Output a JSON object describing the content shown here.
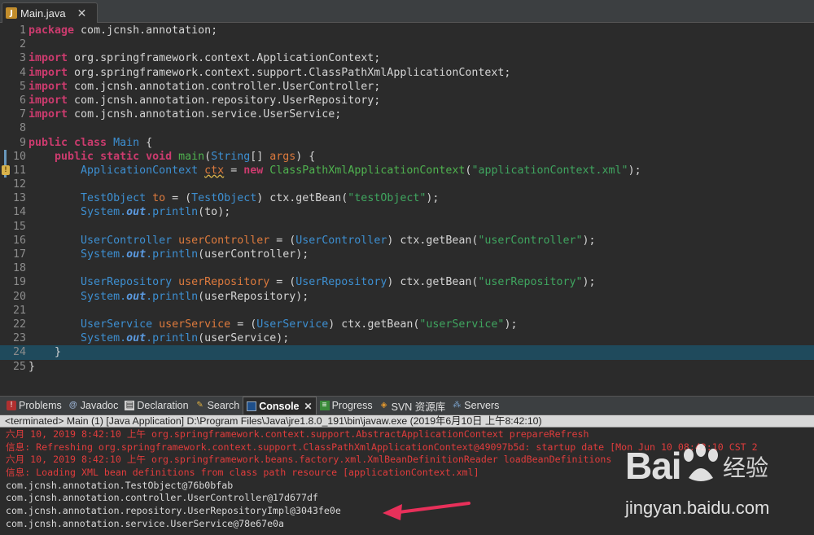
{
  "editor_tab": {
    "label": "Main.java",
    "icon": "java-file-icon",
    "close": "✕"
  },
  "code_lines": [
    {
      "n": "1",
      "parts": [
        [
          "kw",
          "package"
        ],
        [
          "plain",
          " com.jcnsh.annotation;"
        ]
      ]
    },
    {
      "n": "2",
      "parts": []
    },
    {
      "n": "3",
      "parts": [
        [
          "kw",
          "import"
        ],
        [
          "plain",
          " org.springframework.context.ApplicationContext;"
        ]
      ]
    },
    {
      "n": "4",
      "parts": [
        [
          "kw",
          "import"
        ],
        [
          "plain",
          " org.springframework.context.support.ClassPathXmlApplicationContext;"
        ]
      ]
    },
    {
      "n": "5",
      "parts": [
        [
          "kw",
          "import"
        ],
        [
          "plain",
          " com.jcnsh.annotation.controller.UserController;"
        ]
      ]
    },
    {
      "n": "6",
      "parts": [
        [
          "kw",
          "import"
        ],
        [
          "plain",
          " com.jcnsh.annotation.repository.UserRepository;"
        ]
      ]
    },
    {
      "n": "7",
      "parts": [
        [
          "kw",
          "import"
        ],
        [
          "plain",
          " com.jcnsh.annotation.service.UserService;"
        ]
      ]
    },
    {
      "n": "8",
      "parts": []
    },
    {
      "n": "9",
      "parts": [
        [
          "kw",
          "public class "
        ],
        [
          "type",
          "Main"
        ],
        [
          "plain",
          " {"
        ]
      ]
    },
    {
      "n": "10",
      "bar": true,
      "parts": [
        [
          "plain",
          "    "
        ],
        [
          "kw",
          "public static void "
        ],
        [
          "fn",
          "main"
        ],
        [
          "plain",
          "("
        ],
        [
          "type",
          "String"
        ],
        [
          "plain",
          "[] "
        ],
        [
          "var",
          "args"
        ],
        [
          "plain",
          ") {"
        ]
      ]
    },
    {
      "n": "11",
      "bar": true,
      "warn": true,
      "parts": [
        [
          "plain",
          "        "
        ],
        [
          "type",
          "ApplicationContext "
        ],
        [
          "var squig",
          "ctx"
        ],
        [
          "plain",
          " = "
        ],
        [
          "kw",
          "new "
        ],
        [
          "fn",
          "ClassPathXmlApplicationContext"
        ],
        [
          "plain",
          "("
        ],
        [
          "str",
          "\"applicationContext.xml\""
        ],
        [
          "plain",
          ");"
        ]
      ]
    },
    {
      "n": "12",
      "parts": []
    },
    {
      "n": "13",
      "parts": [
        [
          "plain",
          "        "
        ],
        [
          "type",
          "TestObject "
        ],
        [
          "var",
          "to"
        ],
        [
          "plain",
          " = ("
        ],
        [
          "type",
          "TestObject"
        ],
        [
          "plain",
          ") ctx.getBean("
        ],
        [
          "str",
          "\"testObject\""
        ],
        [
          "plain",
          ");"
        ]
      ]
    },
    {
      "n": "14",
      "parts": [
        [
          "plain",
          "        "
        ],
        [
          "type",
          "System."
        ],
        [
          "fld",
          "out"
        ],
        [
          "type",
          ".println"
        ],
        [
          "plain",
          "(to);"
        ]
      ]
    },
    {
      "n": "15",
      "parts": []
    },
    {
      "n": "16",
      "parts": [
        [
          "plain",
          "        "
        ],
        [
          "type",
          "UserController "
        ],
        [
          "var",
          "userController"
        ],
        [
          "plain",
          " = ("
        ],
        [
          "type",
          "UserController"
        ],
        [
          "plain",
          ") ctx.getBean("
        ],
        [
          "str",
          "\"userController\""
        ],
        [
          "plain",
          ");"
        ]
      ]
    },
    {
      "n": "17",
      "parts": [
        [
          "plain",
          "        "
        ],
        [
          "type",
          "System."
        ],
        [
          "fld",
          "out"
        ],
        [
          "type",
          ".println"
        ],
        [
          "plain",
          "(userController);"
        ]
      ]
    },
    {
      "n": "18",
      "parts": []
    },
    {
      "n": "19",
      "parts": [
        [
          "plain",
          "        "
        ],
        [
          "type",
          "UserRepository "
        ],
        [
          "var",
          "userRepository"
        ],
        [
          "plain",
          " = ("
        ],
        [
          "type",
          "UserRepository"
        ],
        [
          "plain",
          ") ctx.getBean("
        ],
        [
          "str",
          "\"userRepository\""
        ],
        [
          "plain",
          ");"
        ]
      ]
    },
    {
      "n": "20",
      "parts": [
        [
          "plain",
          "        "
        ],
        [
          "type",
          "System."
        ],
        [
          "fld",
          "out"
        ],
        [
          "type",
          ".println"
        ],
        [
          "plain",
          "(userRepository);"
        ]
      ]
    },
    {
      "n": "21",
      "parts": []
    },
    {
      "n": "22",
      "parts": [
        [
          "plain",
          "        "
        ],
        [
          "type",
          "UserService "
        ],
        [
          "var",
          "userService"
        ],
        [
          "plain",
          " = ("
        ],
        [
          "type",
          "UserService"
        ],
        [
          "plain",
          ") ctx.getBean("
        ],
        [
          "str",
          "\"userService\""
        ],
        [
          "plain",
          ");"
        ]
      ]
    },
    {
      "n": "23",
      "parts": [
        [
          "plain",
          "        "
        ],
        [
          "type",
          "System."
        ],
        [
          "fld",
          "out"
        ],
        [
          "type",
          ".println"
        ],
        [
          "plain",
          "(userService);"
        ]
      ]
    },
    {
      "n": "24",
      "current": true,
      "parts": [
        [
          "plain",
          "    }"
        ]
      ]
    },
    {
      "n": "25",
      "parts": [
        [
          "plain",
          "}"
        ]
      ]
    }
  ],
  "views_tabs": [
    {
      "label": "Problems",
      "icon": "problems-icon",
      "glyph": "!",
      "cls": "ic-problems"
    },
    {
      "label": "Javadoc",
      "icon": "javadoc-icon",
      "glyph": "@",
      "cls": "ic-javadoc"
    },
    {
      "label": "Declaration",
      "icon": "declaration-icon",
      "glyph": "▤",
      "cls": "ic-declaration"
    },
    {
      "label": "Search",
      "icon": "search-icon",
      "glyph": "✎",
      "cls": "ic-search"
    },
    {
      "label": "Console",
      "icon": "console-icon",
      "glyph": "",
      "cls": "ic-console",
      "active": true
    },
    {
      "label": "Progress",
      "icon": "progress-icon",
      "glyph": "≡",
      "cls": "ic-progress"
    },
    {
      "label": "SVN 资源库",
      "icon": "svn-repository-icon",
      "glyph": "◈",
      "cls": "ic-svn"
    },
    {
      "label": "Servers",
      "icon": "servers-icon",
      "glyph": "⁂",
      "cls": "ic-servers"
    }
  ],
  "views_close": "✕",
  "console": {
    "header": "<terminated> Main (1) [Java Application] D:\\Program Files\\Java\\jre1.8.0_191\\bin\\javaw.exe (2019年6月10日 上午8:42:10)",
    "lines": [
      {
        "kind": "err",
        "text": "六月 10, 2019 8:42:10 上午 org.springframework.context.support.AbstractApplicationContext prepareRefresh"
      },
      {
        "kind": "err",
        "text": "信息: Refreshing org.springframework.context.support.ClassPathXmlApplicationContext@49097b5d: startup date [Mon Jun 10 08:42:10 CST 2"
      },
      {
        "kind": "err",
        "text": "六月 10, 2019 8:42:10 上午 org.springframework.beans.factory.xml.XmlBeanDefinitionReader loadBeanDefinitions"
      },
      {
        "kind": "err",
        "text": "信息: Loading XML bean definitions from class path resource [applicationContext.xml]"
      },
      {
        "kind": "out",
        "text": "com.jcnsh.annotation.TestObject@76b0bfab"
      },
      {
        "kind": "out",
        "text": "com.jcnsh.annotation.controller.UserController@17d677df"
      },
      {
        "kind": "out",
        "text": "com.jcnsh.annotation.repository.UserRepositoryImpl@3043fe0e"
      },
      {
        "kind": "out",
        "text": "com.jcnsh.annotation.service.UserService@78e67e0a"
      }
    ]
  },
  "watermark": {
    "logo": "Bai",
    "logo_suffix": "经验",
    "url": "jingyan.baidu.com"
  },
  "colors": {
    "arrow": "#e8305a",
    "keyword": "#cc3b6e",
    "type": "#3d8fd1",
    "string": "#3fa55f",
    "error_text": "#e03c3c"
  }
}
